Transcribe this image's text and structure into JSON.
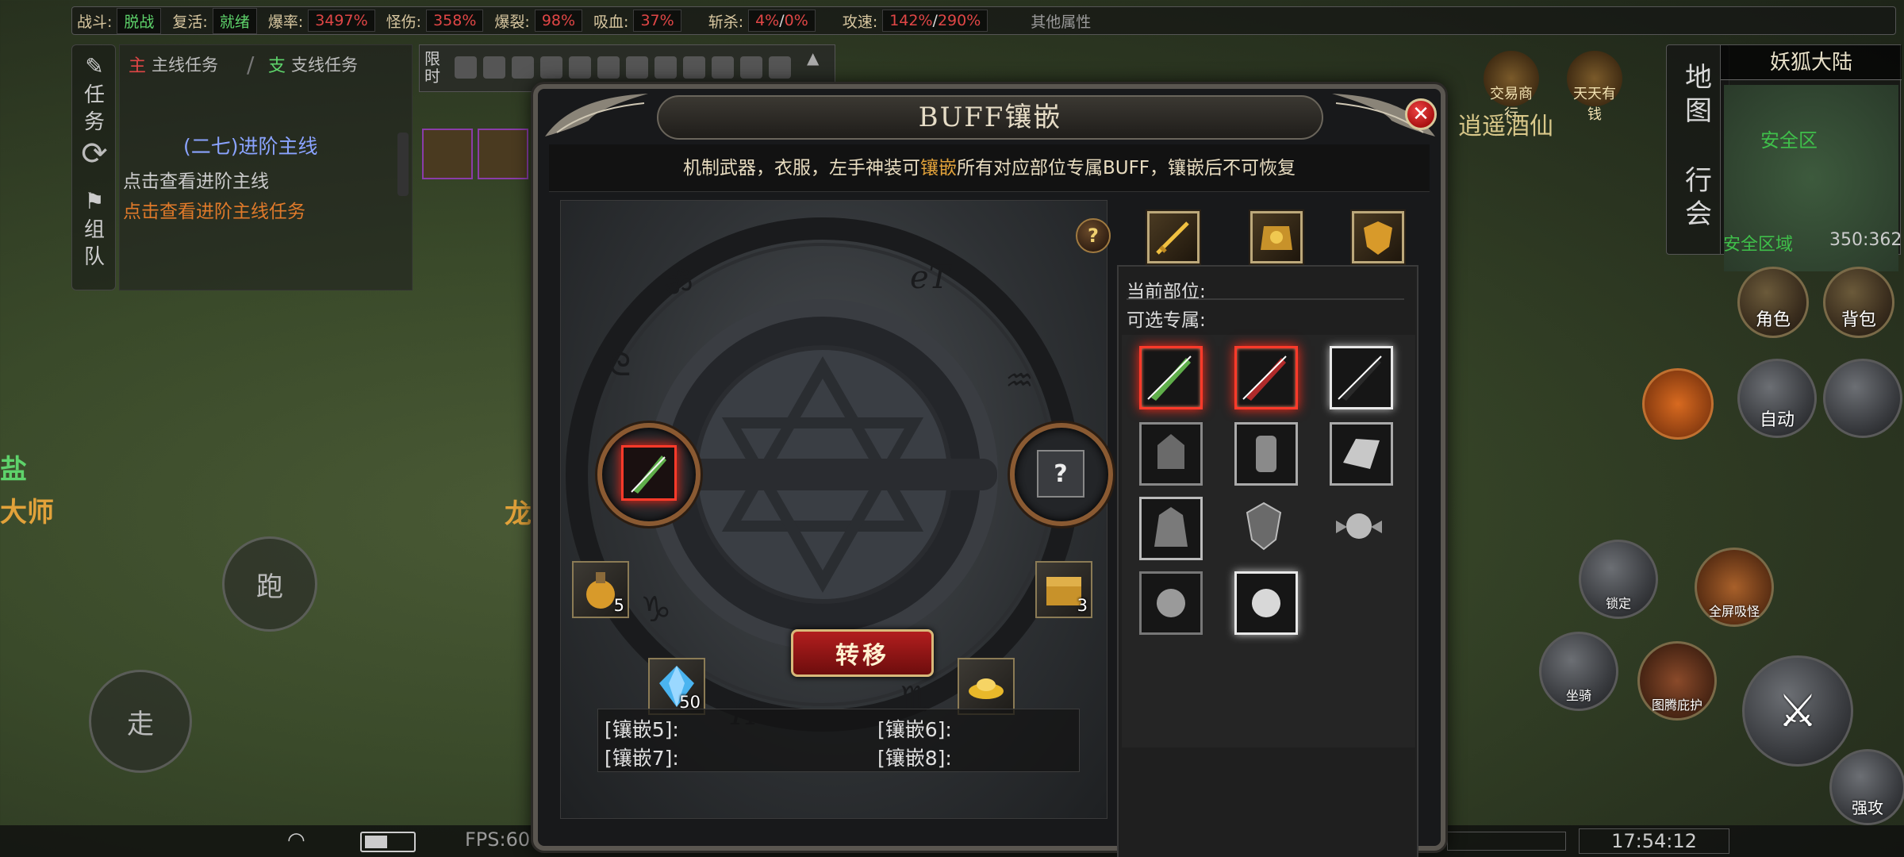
{
  "topbar": {
    "stats": [
      {
        "label": "战斗:",
        "value": "脱战",
        "color": "green"
      },
      {
        "label": "复活:",
        "value": "就绪",
        "color": "green"
      },
      {
        "label": "爆率:",
        "value": "3497%",
        "color": "red"
      },
      {
        "label": "怪伤:",
        "value": "358%",
        "color": "red"
      },
      {
        "label": "爆裂:",
        "value": "98%",
        "color": "red"
      },
      {
        "label": "吸血:",
        "value": "37%",
        "color": "red"
      }
    ],
    "kill": {
      "label": "斩杀:",
      "v1": "4%",
      "sep": "/",
      "v2": "0%"
    },
    "speed": {
      "label": "攻速:",
      "v1": "142%",
      "sep": "/",
      "v2": "290%"
    },
    "other": "其他属性"
  },
  "quest": {
    "side_task": "任务",
    "side_team": "组队",
    "tab_main_badge": "主",
    "tab_main": "主线任务",
    "tab_branch_badge": "支",
    "tab_branch": "支线任务",
    "title": "(二七)进阶主线",
    "line1": "点击查看进阶主线",
    "line2": "点击查看进阶主线任务"
  },
  "limited_label": "限时",
  "right": {
    "map_btn": "地图",
    "guild_btn": "行会",
    "map_name": "妖狐大陆",
    "safe_zone": "安全区",
    "safe_area": "安全区域",
    "coords": "350:362",
    "banner1": "交易商行",
    "banner2": "天天有钱",
    "banner3": "逍遥酒仙",
    "btn_role": "角色",
    "btn_bag": "背包",
    "btn_auto": "自动",
    "btn_fullscreen": "全屏吸怪",
    "btn_mount": "坐骑",
    "btn_guard": "图腾庇护",
    "btn_force": "强攻",
    "btn_lock": "锁定"
  },
  "left": {
    "run": "跑",
    "walk": "走",
    "npc1": "盐",
    "npc2": "大师",
    "npc3": "龙"
  },
  "bottom": {
    "fps": "FPS:60",
    "clock": "17:54:12"
  },
  "dialog": {
    "title": "BUFF镶嵌",
    "close": "✕",
    "desc_prefix": "机制武器，衣服，左手神装可",
    "desc_highlight": "镶嵌",
    "desc_suffix": "所有对应部位专属BUFF，镶嵌后不可恢复",
    "help": "?",
    "right_slot": "?",
    "transfer": "转移",
    "count_potion": "5",
    "count_box": "3",
    "count_crystal": "50",
    "inlay5": "[镶嵌5]:",
    "inlay6": "[镶嵌6]:",
    "inlay7": "[镶嵌7]:",
    "inlay8": "[镶嵌8]:",
    "current_part": "当前部位:",
    "optional": "可选专属:"
  },
  "colors": {
    "accent_red": "#e04646",
    "accent_green": "#5ed36b",
    "gold": "#e2a23a"
  }
}
